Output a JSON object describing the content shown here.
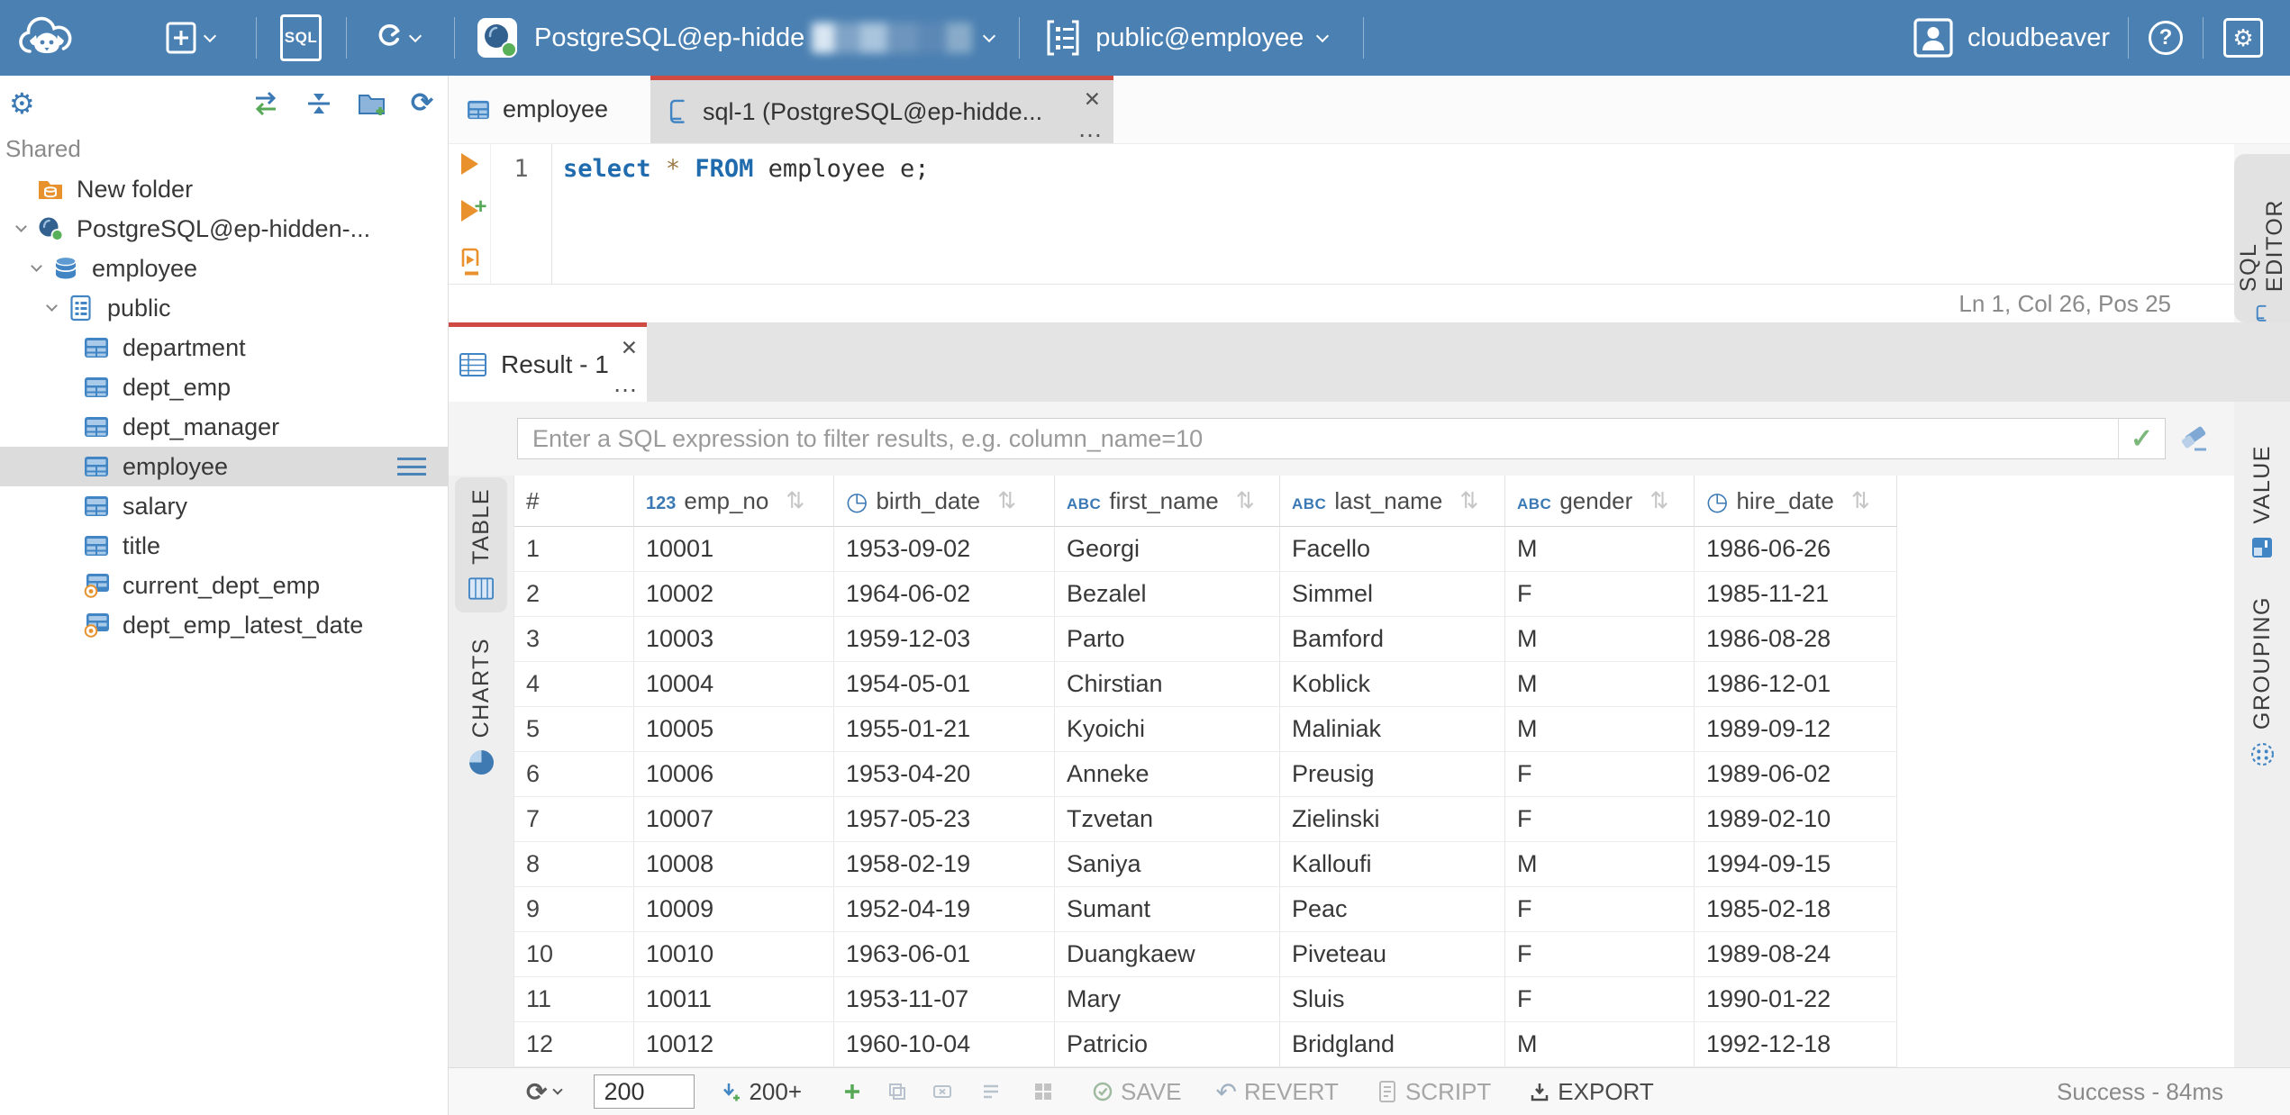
{
  "topbar": {
    "sql_badge": "SQL",
    "connection": {
      "name": "PostgreSQL@ep-hidde",
      "masked": true
    },
    "schema_selector": "public@employee",
    "user_name": "cloudbeaver"
  },
  "sidebar": {
    "section_label": "Shared",
    "tree": [
      {
        "label": "New folder",
        "icon": "folder-db",
        "indent": "lvl0",
        "chev": "",
        "row": ""
      },
      {
        "label": "PostgreSQL@ep-hidden-...",
        "icon": "postgres",
        "indent": "lvl0",
        "chev": "has-chev",
        "row": ""
      },
      {
        "label": "employee",
        "icon": "database",
        "indent": "lvl1",
        "chev": "has-chev",
        "row": ""
      },
      {
        "label": "public",
        "icon": "schema",
        "indent": "lvl2",
        "chev": "has-chev",
        "row": ""
      },
      {
        "label": "department",
        "icon": "table",
        "indent": "lvl3",
        "chev": "",
        "row": ""
      },
      {
        "label": "dept_emp",
        "icon": "table",
        "indent": "lvl3",
        "chev": "",
        "row": ""
      },
      {
        "label": "dept_manager",
        "icon": "table",
        "indent": "lvl3",
        "chev": "",
        "row": ""
      },
      {
        "label": "employee",
        "icon": "table",
        "indent": "lvl3",
        "chev": "",
        "row": "selected"
      },
      {
        "label": "salary",
        "icon": "table",
        "indent": "lvl3",
        "chev": "",
        "row": ""
      },
      {
        "label": "title",
        "icon": "table",
        "indent": "lvl3",
        "chev": "",
        "row": ""
      },
      {
        "label": "current_dept_emp",
        "icon": "view",
        "indent": "lvl3",
        "chev": "",
        "row": ""
      },
      {
        "label": "dept_emp_latest_date",
        "icon": "view",
        "indent": "lvl3",
        "chev": "",
        "row": ""
      }
    ]
  },
  "tabs": {
    "employee": "employee",
    "sql": "sql-1 (PostgreSQL@ep-hidde..."
  },
  "editor": {
    "line_number": "1",
    "code": {
      "kw1": "select",
      "star": "*",
      "kw2": "FROM",
      "rest": "employee e;",
      "text": "select * FROM employee e;"
    },
    "status": "Ln 1, Col 26, Pos 25",
    "side_tab": "SQL EDITOR"
  },
  "result": {
    "tab": "Result - 1",
    "filter_placeholder": "Enter a SQL expression to filter results, e.g. column_name=10",
    "left_tabs": {
      "table": "TABLE",
      "charts": "CHARTS"
    },
    "right_tabs": {
      "value": "VALUE",
      "grouping": "GROUPING"
    },
    "grid": {
      "columns": [
        {
          "type": "rownum",
          "label": "#"
        },
        {
          "type": "num",
          "label": "emp_no"
        },
        {
          "type": "date",
          "label": "birth_date"
        },
        {
          "type": "str",
          "label": "first_name"
        },
        {
          "type": "str",
          "label": "last_name"
        },
        {
          "type": "str",
          "label": "gender"
        },
        {
          "type": "date",
          "label": "hire_date"
        }
      ],
      "rows": [
        {
          "cells": [
            "1",
            "10001",
            "1953-09-02",
            "Georgi",
            "Facello",
            "M",
            "1986-06-26"
          ]
        },
        {
          "cells": [
            "2",
            "10002",
            "1964-06-02",
            "Bezalel",
            "Simmel",
            "F",
            "1985-11-21"
          ]
        },
        {
          "cells": [
            "3",
            "10003",
            "1959-12-03",
            "Parto",
            "Bamford",
            "M",
            "1986-08-28"
          ]
        },
        {
          "cells": [
            "4",
            "10004",
            "1954-05-01",
            "Chirstian",
            "Koblick",
            "M",
            "1986-12-01"
          ]
        },
        {
          "cells": [
            "5",
            "10005",
            "1955-01-21",
            "Kyoichi",
            "Maliniak",
            "M",
            "1989-09-12"
          ]
        },
        {
          "cells": [
            "6",
            "10006",
            "1953-04-20",
            "Anneke",
            "Preusig",
            "F",
            "1989-06-02"
          ]
        },
        {
          "cells": [
            "7",
            "10007",
            "1957-05-23",
            "Tzvetan",
            "Zielinski",
            "F",
            "1989-02-10"
          ]
        },
        {
          "cells": [
            "8",
            "10008",
            "1958-02-19",
            "Saniya",
            "Kalloufi",
            "M",
            "1994-09-15"
          ]
        },
        {
          "cells": [
            "9",
            "10009",
            "1952-04-19",
            "Sumant",
            "Peac",
            "F",
            "1985-02-18"
          ]
        },
        {
          "cells": [
            "10",
            "10010",
            "1963-06-01",
            "Duangkaew",
            "Piveteau",
            "F",
            "1989-08-24"
          ]
        },
        {
          "cells": [
            "11",
            "10011",
            "1953-11-07",
            "Mary",
            "Sluis",
            "F",
            "1990-01-22"
          ]
        },
        {
          "cells": [
            "12",
            "10012",
            "1960-10-04",
            "Patricio",
            "Bridgland",
            "M",
            "1992-12-18"
          ]
        }
      ]
    }
  },
  "toolbar": {
    "fetch_size": "200",
    "fetch_page_label": "200+",
    "save_label": "SAVE",
    "revert_label": "REVERT",
    "script_label": "SCRIPT",
    "export_label": "EXPORT",
    "status": "Success - 84ms"
  },
  "icons": {
    "numeric-type-icon": "123",
    "string-type-icon": "ABC",
    "date-type-icon": "◷",
    "sort-icon": "⇅",
    "close-icon": "✕",
    "more-icon": "…",
    "check-icon": "✓",
    "refresh-icon": "⟳",
    "revert-icon": "↶",
    "gear-icon": "⚙",
    "help-icon": "?"
  },
  "colors": {
    "topbar_blue": "#4b80b2",
    "accent_red": "#d04a44",
    "icon_blue": "#3b79b5",
    "table_icon_blue": "#4285c4",
    "selected_gray": "#dcdcdc",
    "success_green": "#57a857",
    "folder_orange": "#e8922e",
    "exec_orange": "#e8912d"
  }
}
